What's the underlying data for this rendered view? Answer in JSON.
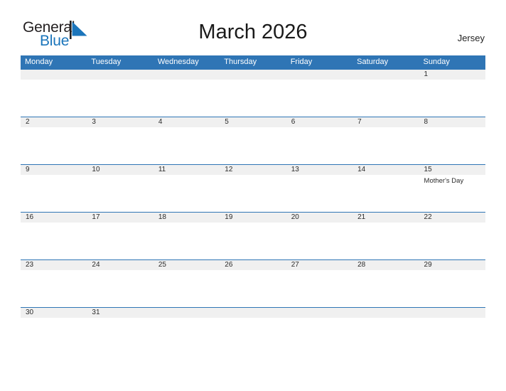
{
  "brand": {
    "name_part1": "General",
    "name_part2": "Blue",
    "flag_icon": "blue-triangle-flag-icon",
    "accent_color": "#1b75bb"
  },
  "header": {
    "title": "March 2026",
    "locale": "Jersey"
  },
  "theme": {
    "header_blue": "#2f75b5",
    "band_gray": "#f0f0f0",
    "row_line": "#2f75b5",
    "text": "#2b2b2b"
  },
  "calendar": {
    "month": "March",
    "year": "2026",
    "weekday_headers": [
      "Monday",
      "Tuesday",
      "Wednesday",
      "Thursday",
      "Friday",
      "Saturday",
      "Sunday"
    ],
    "weeks": [
      {
        "days": [
          {
            "num": "",
            "event": ""
          },
          {
            "num": "",
            "event": ""
          },
          {
            "num": "",
            "event": ""
          },
          {
            "num": "",
            "event": ""
          },
          {
            "num": "",
            "event": ""
          },
          {
            "num": "",
            "event": ""
          },
          {
            "num": "1",
            "event": ""
          }
        ]
      },
      {
        "days": [
          {
            "num": "2",
            "event": ""
          },
          {
            "num": "3",
            "event": ""
          },
          {
            "num": "4",
            "event": ""
          },
          {
            "num": "5",
            "event": ""
          },
          {
            "num": "6",
            "event": ""
          },
          {
            "num": "7",
            "event": ""
          },
          {
            "num": "8",
            "event": ""
          }
        ]
      },
      {
        "days": [
          {
            "num": "9",
            "event": ""
          },
          {
            "num": "10",
            "event": ""
          },
          {
            "num": "11",
            "event": ""
          },
          {
            "num": "12",
            "event": ""
          },
          {
            "num": "13",
            "event": ""
          },
          {
            "num": "14",
            "event": ""
          },
          {
            "num": "15",
            "event": "Mother's Day"
          }
        ]
      },
      {
        "days": [
          {
            "num": "16",
            "event": ""
          },
          {
            "num": "17",
            "event": ""
          },
          {
            "num": "18",
            "event": ""
          },
          {
            "num": "19",
            "event": ""
          },
          {
            "num": "20",
            "event": ""
          },
          {
            "num": "21",
            "event": ""
          },
          {
            "num": "22",
            "event": ""
          }
        ]
      },
      {
        "days": [
          {
            "num": "23",
            "event": ""
          },
          {
            "num": "24",
            "event": ""
          },
          {
            "num": "25",
            "event": ""
          },
          {
            "num": "26",
            "event": ""
          },
          {
            "num": "27",
            "event": ""
          },
          {
            "num": "28",
            "event": ""
          },
          {
            "num": "29",
            "event": ""
          }
        ]
      },
      {
        "days": [
          {
            "num": "30",
            "event": ""
          },
          {
            "num": "31",
            "event": ""
          },
          {
            "num": "",
            "event": ""
          },
          {
            "num": "",
            "event": ""
          },
          {
            "num": "",
            "event": ""
          },
          {
            "num": "",
            "event": ""
          },
          {
            "num": "",
            "event": ""
          }
        ]
      }
    ]
  }
}
